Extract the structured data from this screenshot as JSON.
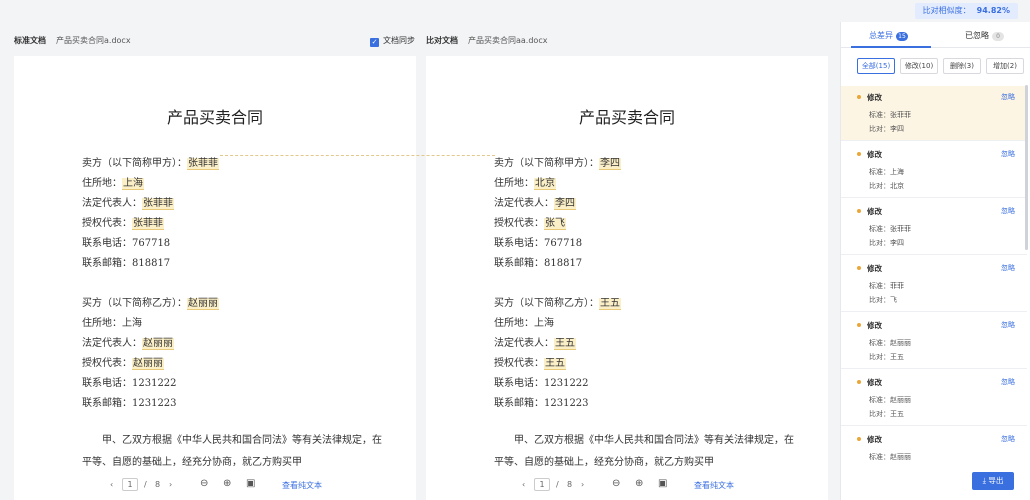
{
  "similarity": {
    "label": "比对相似度：",
    "value": "94.82%"
  },
  "left_doc": {
    "kind": "标准文档",
    "filename": "产品买卖合同a.docx"
  },
  "right_doc": {
    "kind": "比对文档",
    "filename": "产品买卖合同aa.docx"
  },
  "sync": {
    "label": "文档同步"
  },
  "left_page": {
    "title": "产品买卖合同",
    "seller": {
      "label": "卖方（以下简称甲方）：",
      "name": "张菲菲"
    },
    "seller_address": {
      "label": "住所地：",
      "value": "上海"
    },
    "seller_legal": {
      "label": "法定代表人：",
      "value": "张菲菲"
    },
    "seller_auth": {
      "label": "授权代表：",
      "value": "张菲菲"
    },
    "seller_phone": "联系电话：767718",
    "seller_mail": "联系邮箱：818817",
    "buyer": {
      "label": "买方（以下简称乙方）：",
      "name": "赵丽丽"
    },
    "buyer_address": "住所地：上海",
    "buyer_legal": {
      "label": "法定代表人：",
      "value": "赵丽丽"
    },
    "buyer_auth": {
      "label": "授权代表：",
      "value": "赵丽丽"
    },
    "buyer_phone": "联系电话：1231222",
    "buyer_mail": "联系邮箱：1231223",
    "para": "甲、乙双方根据《中华人民共和国合同法》等有关法律规定，在平等、自愿的基础上，经充分协商，就乙方购买甲"
  },
  "right_page": {
    "title": "产品买卖合同",
    "seller": {
      "label": "卖方（以下简称甲方）：",
      "name": "李四"
    },
    "seller_address": {
      "label": "住所地：",
      "value": "北京"
    },
    "seller_legal": {
      "label": "法定代表人：",
      "value": "李四"
    },
    "seller_auth": {
      "label": "授权代表：",
      "value": "张飞"
    },
    "seller_phone": "联系电话：767718",
    "seller_mail": "联系邮箱：818817",
    "buyer": {
      "label": "买方（以下简称乙方）：",
      "name": "王五"
    },
    "buyer_address": "住所地：上海",
    "buyer_legal": {
      "label": "法定代表人：",
      "value": "王五"
    },
    "buyer_auth": {
      "label": "授权代表：",
      "value": "王五"
    },
    "buyer_phone": "联系电话：1231222",
    "buyer_mail": "联系邮箱：1231223",
    "para": "甲、乙双方根据《中华人民共和国合同法》等有关法律规定，在平等、自愿的基础上，经充分协商，就乙方购买甲"
  },
  "pager": {
    "prev": "‹",
    "page": "1",
    "sep": "/",
    "total": "8",
    "next": "›",
    "zoom_out": "⊖",
    "zoom_in": "⊕",
    "fit": "▣",
    "replace_text": "查看纯文本"
  },
  "side": {
    "tab_diff": {
      "label": "总差异",
      "count": "15"
    },
    "tab_ignored": {
      "label": "已忽略",
      "count": "0"
    },
    "filters": [
      "全部(15)",
      "修改(10)",
      "删除(3)",
      "增加(2)"
    ],
    "items": [
      {
        "type": "修改",
        "ignore": "忽略",
        "std": "标准：张菲菲",
        "cmp": "比对：李四"
      },
      {
        "type": "修改",
        "ignore": "忽略",
        "std": "标准：上海",
        "cmp": "比对：北京"
      },
      {
        "type": "修改",
        "ignore": "忽略",
        "std": "标准：张菲菲",
        "cmp": "比对：李四"
      },
      {
        "type": "修改",
        "ignore": "忽略",
        "std": "标准：菲菲",
        "cmp": "比对：飞"
      },
      {
        "type": "修改",
        "ignore": "忽略",
        "std": "标准：赵丽丽",
        "cmp": "比对：王五"
      },
      {
        "type": "修改",
        "ignore": "忽略",
        "std": "标准：赵丽丽",
        "cmp": "比对：王五"
      },
      {
        "type": "修改",
        "ignore": "忽略",
        "std": "标准：赵丽丽",
        "cmp": ""
      }
    ],
    "export": "导出"
  }
}
